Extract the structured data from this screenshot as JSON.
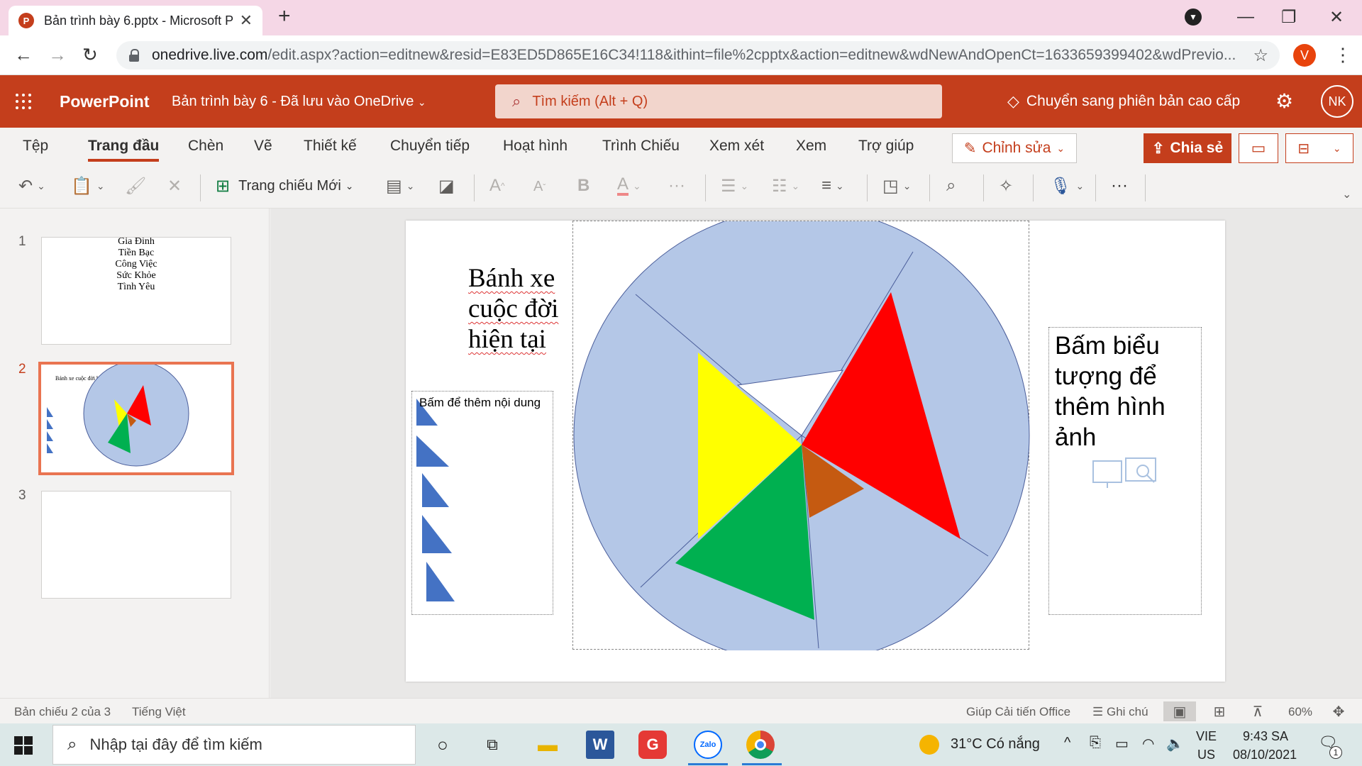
{
  "browser": {
    "tab_title": "Bản trình bày 6.pptx - Microsoft P",
    "tab_close": "✕",
    "new_tab": "+",
    "url_host": "onedrive.live.com",
    "url_rest": "/edit.aspx?action=editnew&resid=E83ED5D865E16C34!118&ithint=file%2cpptx&action=editnew&wdNewAndOpenCt=1633659399402&wdPrevio...",
    "profile_initial": "V",
    "window_controls": {
      "minimize": "—",
      "restore": "❐",
      "close": "✕"
    }
  },
  "app": {
    "name": "PowerPoint",
    "doc_title": "Bản trình bày 6  -  Đã lưu vào OneDrive",
    "search_placeholder": "Tìm kiếm (Alt + Q)",
    "premium": "Chuyển sang phiên bản cao cấp",
    "user_initials": "NK",
    "brand_color": "#c43e1c"
  },
  "ribbon": {
    "tabs": [
      "Tệp",
      "Trang đầu",
      "Chèn",
      "Vẽ",
      "Thiết kế",
      "Chuyển tiếp",
      "Hoạt hình",
      "Trình Chiếu",
      "Xem xét",
      "Xem",
      "Trợ giúp"
    ],
    "active_tab": "Trang đầu",
    "edit_label": "Chỉnh sửa",
    "share_label": "Chia sẻ",
    "new_slide_label": "Trang chiếu Mới",
    "font_bold": "B",
    "font_grow": "A",
    "font_shrink": "A",
    "font_color": "A",
    "more": "···"
  },
  "thumbnails": {
    "numbers": [
      "1",
      "2",
      "3"
    ],
    "slide1_lines": [
      "Gia Đình",
      "Tiền Bạc",
      "Công Việc",
      "Sức Khỏe",
      "Tình Yêu"
    ],
    "slide2_title": "Bánh xe cuộc đời hiện tại"
  },
  "slide": {
    "title_lines": [
      "Bánh xe",
      "cuộc đời",
      "hiện tại"
    ],
    "content_placeholder": "Bấm để thêm nội dung",
    "picture_placeholder": "Bấm biểu tượng để thêm hình ảnh",
    "colors": {
      "wheel": "#b4c7e7",
      "yellow": "#ffff00",
      "red": "#ff0000",
      "green": "#00b050",
      "orange": "#c55a11",
      "blue_triangle": "#4472c4"
    }
  },
  "statusbar": {
    "slide_info": "Bản chiếu 2 của 3",
    "language": "Tiếng Việt",
    "feedback": "Giúp Cải tiến Office",
    "notes": "Ghi chú",
    "zoom": "60%"
  },
  "taskbar": {
    "search_placeholder": "Nhập tại đây để tìm kiếm",
    "weather": "31°C  Có nắng",
    "lang_top": "VIE",
    "lang_bottom": "US",
    "time": "9:43 SA",
    "date": "08/10/2021",
    "notification_count": "1"
  }
}
